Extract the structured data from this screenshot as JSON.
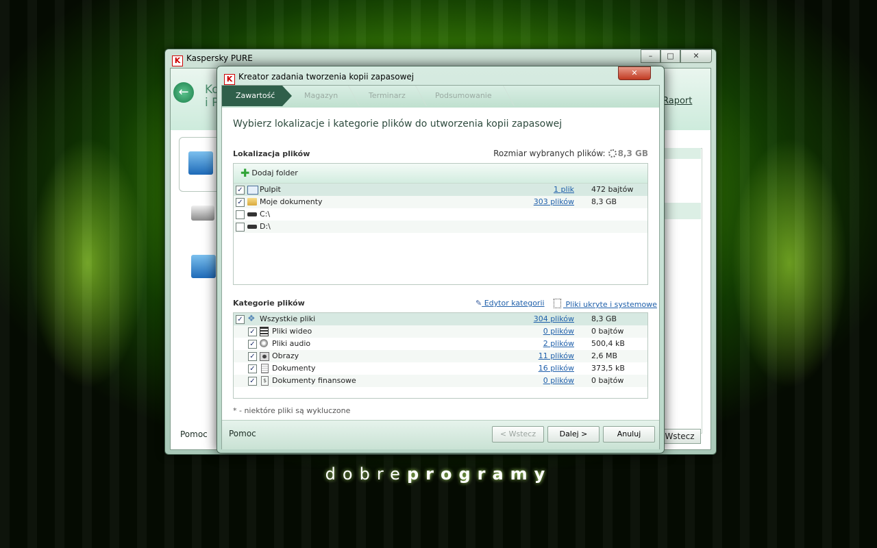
{
  "main_window": {
    "title": "Kaspersky PURE",
    "sys_minimize": "–",
    "sys_maximize": "□",
    "sys_close": "✕",
    "header_text_line1": "Ko",
    "header_text_line2": "i P",
    "back_glyph": "←",
    "raport_label": "Raport",
    "pomoc_label": "Pomoc",
    "wstecz_label": "Wstecz"
  },
  "wizard": {
    "title": "Kreator zadania tworzenia kopii zapasowej",
    "close_glyph": "✕",
    "steps": [
      "Zawartość",
      "Magazyn",
      "Terminarz",
      "Podsumowanie"
    ],
    "heading": "Wybierz lokalizacje i kategorie plików do utworzenia kopii zapasowej",
    "locations_label": "Lokalizacja plików",
    "size_label": "Rozmiar wybranych plików:",
    "size_value": "8,3 GB",
    "add_folder_label": "Dodaj folder",
    "locations": [
      {
        "name": "Pulpit",
        "checked": true,
        "count": "1 plik",
        "size": "472 bajtów"
      },
      {
        "name": "Moje dokumenty",
        "checked": true,
        "count": "303 plików",
        "size": "8,3 GB"
      },
      {
        "name": "C:\\",
        "checked": false,
        "count": "",
        "size": ""
      },
      {
        "name": "D:\\",
        "checked": false,
        "count": "",
        "size": ""
      }
    ],
    "categories_label": "Kategorie plików",
    "category_editor_link": "Edytor kategorii",
    "hidden_files_link": "Pliki ukryte i systemowe",
    "categories": [
      {
        "name": "Wszystkie pliki",
        "checked": true,
        "count": "304 plików",
        "size": "8,3 GB"
      },
      {
        "name": "Pliki wideo",
        "checked": true,
        "count": "0 plików",
        "size": "0 bajtów"
      },
      {
        "name": "Pliki audio",
        "checked": true,
        "count": "2 plików",
        "size": "500,4 kB"
      },
      {
        "name": "Obrazy",
        "checked": true,
        "count": "11 plików",
        "size": "2,6 MB"
      },
      {
        "name": "Dokumenty",
        "checked": true,
        "count": "16 plików",
        "size": "373,5 kB"
      },
      {
        "name": "Dokumenty finansowe",
        "checked": true,
        "count": "0 plików",
        "size": "0 bajtów"
      }
    ],
    "footnote": "* - niektóre pliki są wykluczone",
    "pomoc_label": "Pomoc",
    "back_button": "< Wstecz",
    "next_button": "Dalej >",
    "cancel_button": "Anuluj"
  },
  "watermark": {
    "light": "dobre",
    "bold": "programy"
  },
  "colors": {
    "accent": "#2f5f4a",
    "link": "#1e5faa",
    "background": "#3f8a06"
  }
}
